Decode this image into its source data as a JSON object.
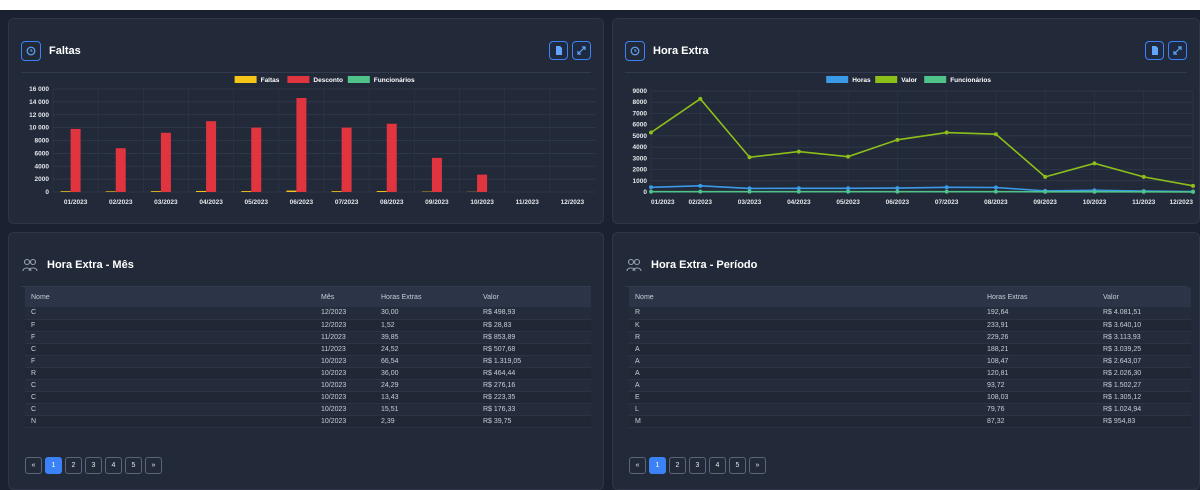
{
  "faltas": {
    "title": "Faltas",
    "icon": "clock-icon",
    "buttons": [
      "export-icon",
      "expand-icon"
    ],
    "chart_data": {
      "type": "bar",
      "categories": [
        "01/2023",
        "02/2023",
        "03/2023",
        "04/2023",
        "05/2023",
        "06/2023",
        "07/2023",
        "08/2023",
        "09/2023",
        "10/2023",
        "11/2023",
        "12/2023"
      ],
      "series": [
        {
          "name": "Faltas",
          "color": "#f5c518",
          "values": [
            120,
            100,
            130,
            160,
            140,
            220,
            130,
            150,
            60,
            30,
            0,
            0
          ]
        },
        {
          "name": "Desconto",
          "color": "#e0343f",
          "values": [
            9800,
            6800,
            9200,
            11000,
            10000,
            14600,
            10000,
            10600,
            5300,
            2700,
            0,
            0
          ]
        },
        {
          "name": "Funcionários",
          "color": "#4fc38a",
          "values": [
            0,
            0,
            0,
            0,
            0,
            0,
            0,
            0,
            0,
            0,
            0,
            0
          ]
        }
      ],
      "yticks": [
        "0",
        "2000",
        "4000",
        "6000",
        "8000",
        "10 000",
        "12 000",
        "14 000",
        "16 000"
      ],
      "ylim": [
        0,
        16000
      ],
      "grid": true,
      "legend": "top-center"
    }
  },
  "hora_extra": {
    "title": "Hora Extra",
    "icon": "clock-icon",
    "buttons": [
      "export-icon",
      "expand-icon"
    ],
    "chart_data": {
      "type": "line",
      "categories": [
        "01/2023",
        "02/2023",
        "03/2023",
        "04/2023",
        "05/2023",
        "06/2023",
        "07/2023",
        "08/2023",
        "09/2023",
        "10/2023",
        "11/2023",
        "12/2023"
      ],
      "series": [
        {
          "name": "Horas",
          "color": "#3b9ae8",
          "values": [
            420,
            550,
            320,
            330,
            330,
            350,
            420,
            400,
            100,
            150,
            80,
            40
          ]
        },
        {
          "name": "Valor",
          "color": "#8dbf1a",
          "values": [
            5300,
            8300,
            3100,
            3600,
            3150,
            4650,
            5300,
            5150,
            1350,
            2550,
            1350,
            550
          ]
        },
        {
          "name": "Funcionários",
          "color": "#4fc38a",
          "values": [
            30,
            30,
            30,
            30,
            30,
            30,
            30,
            30,
            20,
            20,
            20,
            10
          ]
        }
      ],
      "yticks": [
        "0",
        "1000",
        "2000",
        "3000",
        "4000",
        "5000",
        "6000",
        "7000",
        "8000",
        "9000"
      ],
      "ylim": [
        0,
        9000
      ],
      "grid": true,
      "legend": "top-center"
    }
  },
  "hora_extra_mes": {
    "title": "Hora Extra - Mês",
    "columns": [
      "Nome",
      "Mês",
      "Horas Extras",
      "Valor"
    ],
    "rows": [
      [
        "C",
        "12/2023",
        "30,00",
        "R$ 498,93"
      ],
      [
        "F",
        "12/2023",
        "1,52",
        "R$ 28,83"
      ],
      [
        "F",
        "11/2023",
        "39,85",
        "R$ 853,89"
      ],
      [
        "C",
        "11/2023",
        "24,52",
        "R$ 507,68"
      ],
      [
        "F",
        "10/2023",
        "66,54",
        "R$ 1.319,05"
      ],
      [
        "R",
        "10/2023",
        "36,00",
        "R$ 464,44"
      ],
      [
        "C",
        "10/2023",
        "24,29",
        "R$ 276,16"
      ],
      [
        "C",
        "10/2023",
        "13,43",
        "R$ 223,35"
      ],
      [
        "C",
        "10/2023",
        "15,51",
        "R$ 176,33"
      ],
      [
        "N",
        "10/2023",
        "2,39",
        "R$ 39,75"
      ]
    ],
    "pagination": {
      "prev": "«",
      "pages": [
        "1",
        "2",
        "3",
        "4",
        "5"
      ],
      "next": "»",
      "active": "1"
    }
  },
  "hora_extra_periodo": {
    "title": "Hora Extra - Período",
    "columns": [
      "Nome",
      "Horas Extras",
      "Valor"
    ],
    "rows": [
      [
        "R",
        "192,64",
        "R$ 4.081,51"
      ],
      [
        "K",
        "233,91",
        "R$ 3.640,10"
      ],
      [
        "R",
        "229,26",
        "R$ 3.113,93"
      ],
      [
        "A",
        "188,21",
        "R$ 3.039,25"
      ],
      [
        "A",
        "108,47",
        "R$ 2.643,07"
      ],
      [
        "A",
        "120,81",
        "R$ 2.026,30"
      ],
      [
        "A",
        "93,72",
        "R$ 1.502,27"
      ],
      [
        "E",
        "108,03",
        "R$ 1.305,12"
      ],
      [
        "L",
        "79,76",
        "R$ 1.024,94"
      ],
      [
        "M",
        "87,32",
        "R$ 954,83"
      ]
    ],
    "pagination": {
      "prev": "«",
      "pages": [
        "1",
        "2",
        "3",
        "4",
        "5"
      ],
      "next": "»",
      "active": "1"
    }
  }
}
